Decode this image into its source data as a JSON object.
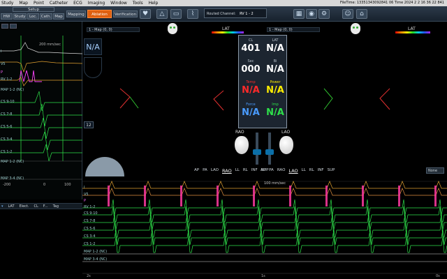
{
  "menu": [
    "Study",
    "Map",
    "Point",
    "Catheter",
    "ECG",
    "Imaging",
    "Window",
    "Tools",
    "Help"
  ],
  "filetime": "FileTime: 13351343092841 06 Time 2024 2 2 16 36 22 841",
  "toolbar": {
    "setup": "Setup",
    "tabs_left": [
      "HW",
      "Study",
      "Loc.",
      "Cath.",
      "Map"
    ],
    "mapping": "Mapping",
    "ablation": "Ablation",
    "verification": "Verification",
    "routed_label": "Routed Channel:",
    "routed_value": "RV 1 - 2"
  },
  "left_panel": {
    "scale": "200 mm/sec",
    "labels": [
      "I",
      "V5",
      "P",
      "RV 1-2",
      "MAP 1-2 (NC)",
      "CS 9-10",
      "CS 7-8",
      "CS 5-6",
      "CS 3-4",
      "CS 1-2",
      "MAP 1-2 (NC)",
      "MAP 3-4 (NC)"
    ],
    "ticks": [
      "-200",
      "0",
      "100"
    ],
    "na": "N/A",
    "counter": "12"
  },
  "map_left": {
    "header": "1 - Map (0, 0)",
    "lat": "LAT"
  },
  "map_right": {
    "header": "1 - Map (0, 0)",
    "lat": "LAT"
  },
  "params": {
    "cl_label": "CL",
    "cl_value": "401",
    "lat_label": "LAT",
    "lat_value": "N/A",
    "sec_label": "Sec",
    "sec_value": "000",
    "bi_label": "Bi",
    "bi_value": "N/A",
    "temp_label": "Temp",
    "temp_value": "N/A",
    "power_label": "Power",
    "power_value": "N/A",
    "force_label": "Force",
    "force_value": "N/A",
    "imp_label": "Imp",
    "imp_value": "N/A",
    "colors": {
      "temp": "#ff2a2a",
      "power": "#ffee00",
      "force": "#4a9cff",
      "imp": "#2ee04a"
    }
  },
  "views": {
    "rao_label": "RAO",
    "lao_label": "LAO",
    "left_buttons": [
      "AP",
      "PA",
      "LAO",
      "RAO",
      "LL",
      "RL",
      "INF",
      "SUP"
    ],
    "right_buttons": [
      "AP",
      "PA",
      "RAO",
      "LAO",
      "LL",
      "RL",
      "INF",
      "SUP"
    ],
    "none": "None"
  },
  "list_header": [
    "LAT",
    "Elect.",
    "CL",
    "F...",
    "Tag"
  ],
  "strip": {
    "scale": "100 mm/sec",
    "labels": [
      "I",
      "V5",
      "P",
      "RV 1-2",
      "CS 9-10",
      "CS 7-8",
      "CS 5-6",
      "CS 3-4",
      "CS 1-2",
      "MAP 1-2 (NC)",
      "MAP 3-4 (NC)"
    ],
    "time_ticks": [
      "2s",
      "1s",
      "0s"
    ]
  }
}
